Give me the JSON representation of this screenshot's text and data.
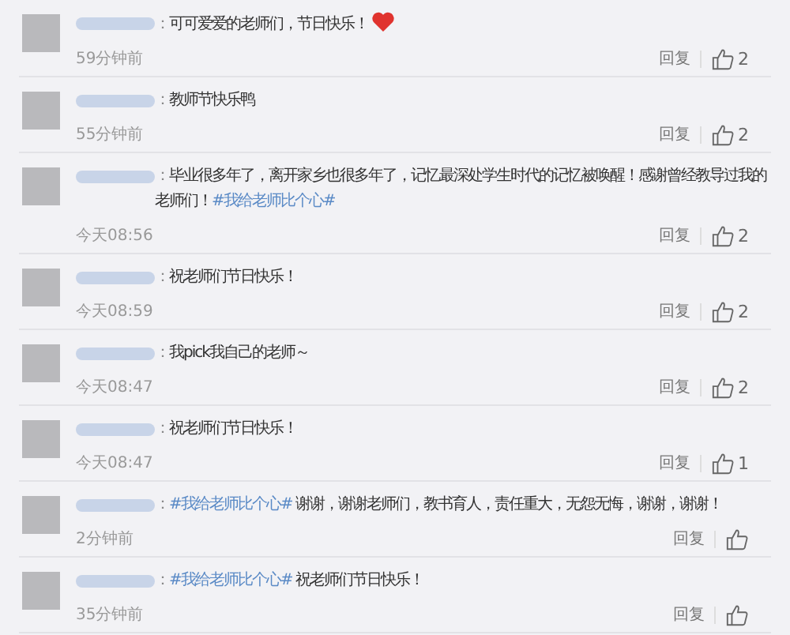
{
  "comments": [
    {
      "separator": "：",
      "segments": [
        {
          "kind": "text",
          "text": "可可爱爱的老师们，节日快乐！"
        },
        {
          "kind": "heart"
        }
      ],
      "time": "59分钟前",
      "reply": "回复",
      "likes": "2"
    },
    {
      "separator": "：",
      "segments": [
        {
          "kind": "text",
          "text": "教师节快乐鸭"
        }
      ],
      "time": "55分钟前",
      "reply": "回复",
      "likes": "2"
    },
    {
      "separator": "：",
      "segments": [
        {
          "kind": "text",
          "text": "毕业很多年了，离开家乡也很多年了，记忆最深处学生时代的记忆被唤醒！感谢曾经教导过我的老师们！"
        },
        {
          "kind": "hashtag",
          "text": "#我给老师比个心#"
        }
      ],
      "time": "今天08:56",
      "reply": "回复",
      "likes": "2"
    },
    {
      "separator": "：",
      "segments": [
        {
          "kind": "text",
          "text": "祝老师们节日快乐！"
        }
      ],
      "time": "今天08:59",
      "reply": "回复",
      "likes": "2"
    },
    {
      "separator": "：",
      "segments": [
        {
          "kind": "text",
          "text": "我pick我自己的老师～"
        }
      ],
      "time": "今天08:47",
      "reply": "回复",
      "likes": "2"
    },
    {
      "separator": "：",
      "segments": [
        {
          "kind": "text",
          "text": "祝老师们节日快乐！"
        }
      ],
      "time": "今天08:47",
      "reply": "回复",
      "likes": "1"
    },
    {
      "separator": "：",
      "segments": [
        {
          "kind": "hashtag",
          "text": "#我给老师比个心#"
        },
        {
          "kind": "text",
          "text": " 谢谢，谢谢老师们，教书育人，责任重大，无怨无悔，谢谢，谢谢！"
        }
      ],
      "time": "2分钟前",
      "reply": "回复"
    },
    {
      "separator": "：",
      "segments": [
        {
          "kind": "hashtag",
          "text": "#我给老师比个心#"
        },
        {
          "kind": "text",
          "text": " 祝老师们节日快乐！"
        }
      ],
      "time": "35分钟前",
      "reply": "回复"
    }
  ]
}
